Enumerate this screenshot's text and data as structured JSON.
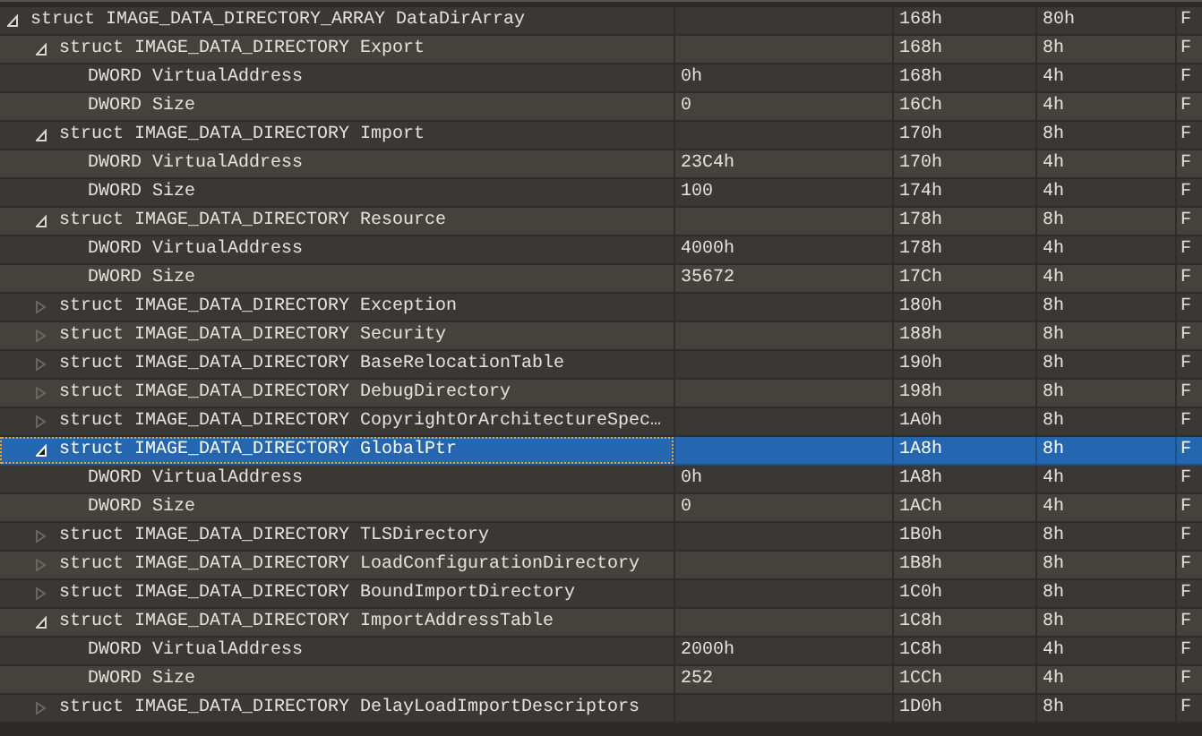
{
  "tree": {
    "rows": [
      {
        "name": "struct IMAGE_DATA_DIRECTORY_ARRAY DataDirArray",
        "value": "",
        "start": "168h",
        "size": "80h",
        "column_5": "F",
        "expanded": true,
        "selected": false,
        "children": [
          {
            "name": "struct IMAGE_DATA_DIRECTORY Export",
            "start": "168h",
            "size": "8h",
            "column_5": "F",
            "expanded": true,
            "selected": false,
            "children": [
              {
                "name": "DWORD VirtualAddress",
                "value": "0h",
                "start": "168h",
                "size": "4h",
                "column_5": "F",
                "selected": false
              },
              {
                "name": "DWORD Size",
                "value": "0",
                "start": "16Ch",
                "size": "4h",
                "column_5": "F",
                "selected": false
              }
            ]
          },
          {
            "name": "struct IMAGE_DATA_DIRECTORY Import",
            "start": "170h",
            "size": "8h",
            "column_5": "F",
            "expanded": true,
            "selected": false,
            "children": [
              {
                "name": "DWORD VirtualAddress",
                "value": "23C4h",
                "start": "170h",
                "size": "4h",
                "column_5": "F",
                "selected": false
              },
              {
                "name": "DWORD Size",
                "value": "100",
                "start": "174h",
                "size": "4h",
                "column_5": "F",
                "selected": false
              }
            ]
          },
          {
            "name": "struct IMAGE_DATA_DIRECTORY Resource",
            "start": "178h",
            "size": "8h",
            "column_5": "F",
            "expanded": true,
            "selected": false,
            "children": [
              {
                "name": "DWORD VirtualAddress",
                "value": "4000h",
                "start": "178h",
                "size": "4h",
                "column_5": "F",
                "selected": false
              },
              {
                "name": "DWORD Size",
                "value": "35672",
                "start": "17Ch",
                "size": "4h",
                "column_5": "F",
                "selected": false
              }
            ]
          },
          {
            "name": "struct IMAGE_DATA_DIRECTORY Exception",
            "start": "180h",
            "size": "8h",
            "column_5": "F",
            "expanded": false,
            "selected": false
          },
          {
            "name": "struct IMAGE_DATA_DIRECTORY Security",
            "start": "188h",
            "size": "8h",
            "column_5": "F",
            "expanded": false,
            "selected": false
          },
          {
            "name": "struct IMAGE_DATA_DIRECTORY BaseRelocationTable",
            "start": "190h",
            "size": "8h",
            "column_5": "F",
            "expanded": false,
            "selected": false
          },
          {
            "name": "struct IMAGE_DATA_DIRECTORY DebugDirectory",
            "start": "198h",
            "size": "8h",
            "column_5": "F",
            "expanded": false,
            "selected": false
          },
          {
            "name": "struct IMAGE_DATA_DIRECTORY CopyrightOrArchitectureSpec…",
            "start": "1A0h",
            "size": "8h",
            "column_5": "F",
            "expanded": false,
            "selected": false
          },
          {
            "name": "struct IMAGE_DATA_DIRECTORY GlobalPtr",
            "start": "1A8h",
            "size": "8h",
            "column_5": "F",
            "expanded": true,
            "selected": true,
            "children": [
              {
                "name": "DWORD VirtualAddress",
                "value": "0h",
                "start": "1A8h",
                "size": "4h",
                "column_5": "F",
                "selected": false
              },
              {
                "name": "DWORD Size",
                "value": "0",
                "start": "1ACh",
                "size": "4h",
                "column_5": "F",
                "selected": false
              }
            ]
          },
          {
            "name": "struct IMAGE_DATA_DIRECTORY TLSDirectory",
            "start": "1B0h",
            "size": "8h",
            "column_5": "F",
            "expanded": false,
            "selected": false
          },
          {
            "name": "struct IMAGE_DATA_DIRECTORY LoadConfigurationDirectory",
            "start": "1B8h",
            "size": "8h",
            "column_5": "F",
            "expanded": false,
            "selected": false
          },
          {
            "name": "struct IMAGE_DATA_DIRECTORY BoundImportDirectory",
            "start": "1C0h",
            "size": "8h",
            "column_5": "F",
            "expanded": false,
            "selected": false
          },
          {
            "name": "struct IMAGE_DATA_DIRECTORY ImportAddressTable",
            "start": "1C8h",
            "size": "8h",
            "column_5": "F",
            "expanded": true,
            "selected": false,
            "children": [
              {
                "name": "DWORD VirtualAddress",
                "value": "2000h",
                "start": "1C8h",
                "size": "4h",
                "column_5": "F",
                "selected": false
              },
              {
                "name": "DWORD Size",
                "value": "252",
                "start": "1CCh",
                "size": "4h",
                "column_5": "F",
                "selected": false
              }
            ]
          },
          {
            "name": "struct IMAGE_DATA_DIRECTORY DelayLoadImportDescriptors",
            "start": "1D0h",
            "size": "8h",
            "column_5": "F",
            "expanded": false,
            "selected": false
          }
        ]
      }
    ]
  }
}
